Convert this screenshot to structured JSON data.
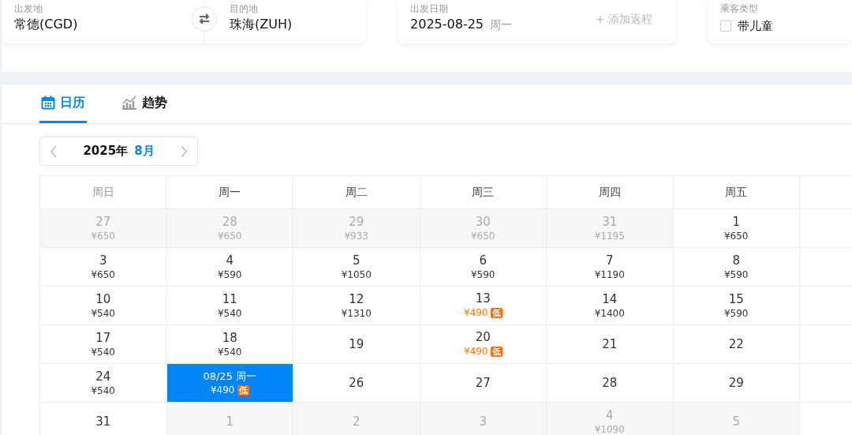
{
  "search": {
    "origin": {
      "label": "出发地",
      "value": "常德(CGD)"
    },
    "destination": {
      "label": "目的地",
      "value": "珠海(ZUH)"
    },
    "date": {
      "label": "出发日期",
      "value": "2025-08-25",
      "weekday": "周一",
      "add_return": "+ 添加返程"
    },
    "passenger": {
      "label": "乘客类型",
      "option": "带儿童",
      "checked": false
    }
  },
  "tabs": [
    {
      "label": "日历",
      "selected": true
    },
    {
      "label": "趋势",
      "selected": false
    }
  ],
  "month_nav": {
    "year": "2025年",
    "month": "8月"
  },
  "weekdays": [
    {
      "label": "周日",
      "weekend": true
    },
    {
      "label": "周一",
      "weekend": false
    },
    {
      "label": "周二",
      "weekend": false
    },
    {
      "label": "周三",
      "weekend": false
    },
    {
      "label": "周四",
      "weekend": false
    },
    {
      "label": "周五",
      "weekend": false
    }
  ],
  "weeks": [
    [
      {
        "day": "27",
        "price": "¥650",
        "muted": true
      },
      {
        "day": "28",
        "price": "¥650",
        "muted": true
      },
      {
        "day": "29",
        "price": "¥933",
        "muted": true
      },
      {
        "day": "30",
        "price": "¥650",
        "muted": true
      },
      {
        "day": "31",
        "price": "¥1195",
        "muted": true
      },
      {
        "day": "1",
        "price": "¥650",
        "muted": false
      }
    ],
    [
      {
        "day": "3",
        "price": "¥650",
        "muted": false
      },
      {
        "day": "4",
        "price": "¥590",
        "muted": false
      },
      {
        "day": "5",
        "price": "¥1050",
        "muted": false
      },
      {
        "day": "6",
        "price": "¥590",
        "muted": false
      },
      {
        "day": "7",
        "price": "¥1190",
        "muted": false
      },
      {
        "day": "8",
        "price": "¥590",
        "muted": false
      }
    ],
    [
      {
        "day": "10",
        "price": "¥540",
        "muted": false
      },
      {
        "day": "11",
        "price": "¥540",
        "muted": false
      },
      {
        "day": "12",
        "price": "¥1310",
        "muted": false
      },
      {
        "day": "13",
        "price": "¥490",
        "low": "低",
        "muted": false
      },
      {
        "day": "14",
        "price": "¥1400",
        "muted": false
      },
      {
        "day": "15",
        "price": "¥590",
        "muted": false
      }
    ],
    [
      {
        "day": "17",
        "price": "¥540",
        "muted": false
      },
      {
        "day": "18",
        "price": "¥540",
        "muted": false
      },
      {
        "day": "19",
        "muted": false
      },
      {
        "day": "20",
        "price": "¥490",
        "low": "低",
        "muted": false
      },
      {
        "day": "21",
        "muted": false
      },
      {
        "day": "22",
        "muted": false
      }
    ],
    [
      {
        "day": "24",
        "price": "¥540",
        "muted": false
      },
      {
        "day": "08/25 周一",
        "price": "¥490",
        "low": "低",
        "muted": false,
        "selected": true
      },
      {
        "day": "26",
        "muted": false
      },
      {
        "day": "27",
        "muted": false
      },
      {
        "day": "28",
        "muted": false
      },
      {
        "day": "29",
        "muted": false
      }
    ],
    [
      {
        "day": "31",
        "muted": false
      },
      {
        "day": "1",
        "muted": true
      },
      {
        "day": "2",
        "muted": true
      },
      {
        "day": "3",
        "muted": true
      },
      {
        "day": "4",
        "price": "¥1090",
        "muted": true
      },
      {
        "day": "5",
        "muted": true
      }
    ]
  ]
}
